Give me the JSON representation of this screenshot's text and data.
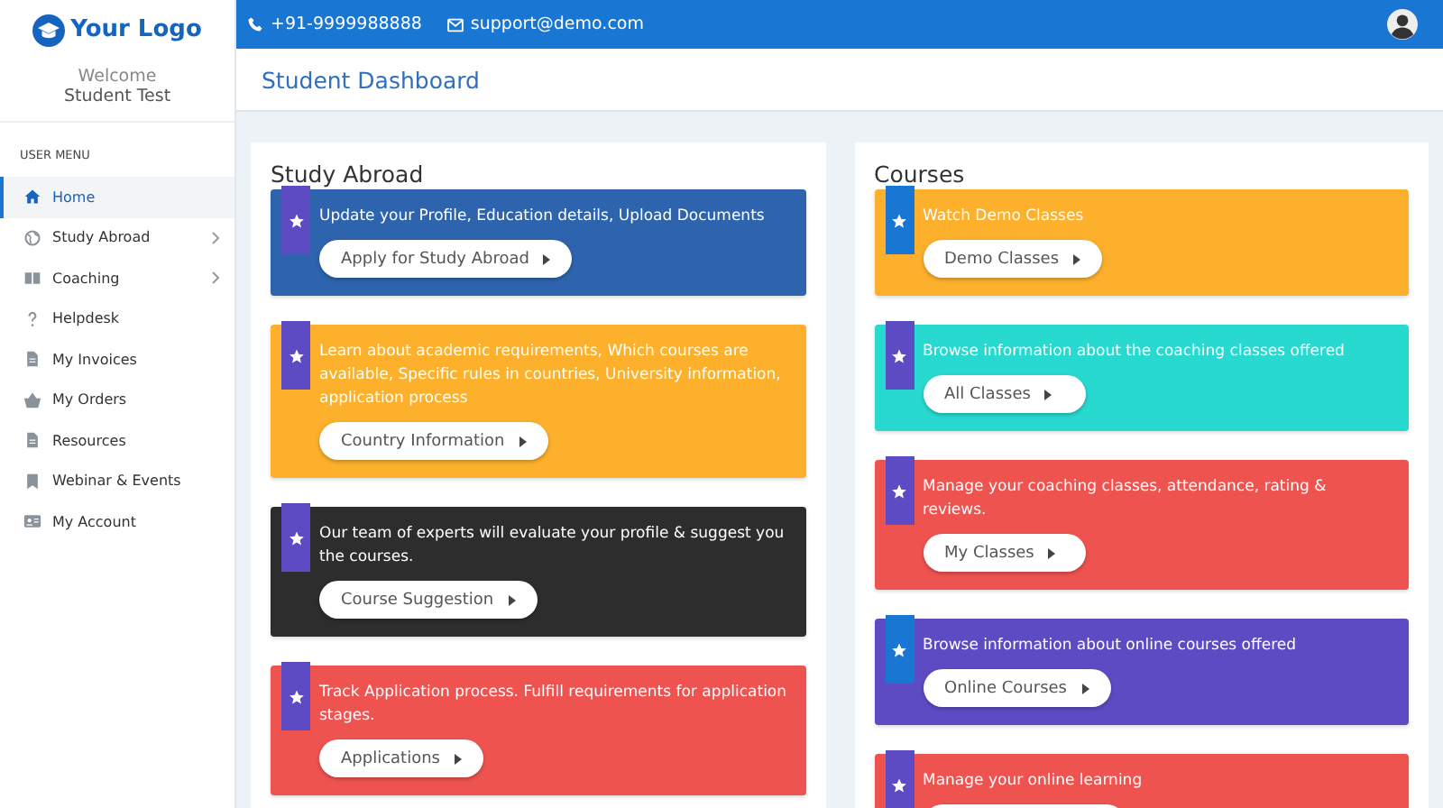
{
  "logo": {
    "text": "Your Logo"
  },
  "welcome": {
    "greeting": "Welcome",
    "name": "Student Test"
  },
  "topbar": {
    "phone": "+91-9999988888",
    "email": "support@demo.com"
  },
  "sidebar": {
    "heading": "USER MENU",
    "items": [
      {
        "label": "Home",
        "selected": true,
        "expandable": false
      },
      {
        "label": "Study Abroad",
        "selected": false,
        "expandable": true
      },
      {
        "label": "Coaching",
        "selected": false,
        "expandable": true
      },
      {
        "label": "Helpdesk",
        "selected": false,
        "expandable": false
      },
      {
        "label": "My Invoices",
        "selected": false,
        "expandable": false
      },
      {
        "label": "My Orders",
        "selected": false,
        "expandable": false
      },
      {
        "label": "Resources",
        "selected": false,
        "expandable": false
      },
      {
        "label": "Webinar & Events",
        "selected": false,
        "expandable": false
      },
      {
        "label": "My Account",
        "selected": false,
        "expandable": false
      }
    ]
  },
  "page_title": "Student Dashboard",
  "panels": [
    {
      "title": "Study Abroad",
      "cards": [
        {
          "text": "Update your Profile, Education details, Upload Documents",
          "button": "Apply for Study Abroad",
          "color": "#2e64ae",
          "ribbon": {
            "color": "#5d4bc4"
          }
        },
        {
          "text": "Learn about academic requirements, Which courses are available, Specific rules in countries, University information, application process",
          "button": "Country Information",
          "color": "#fcb02c",
          "ribbon": {
            "color": "#5d4bc4"
          }
        },
        {
          "text": "Our team of experts will evaluate your profile & suggest you the courses.",
          "button": "Course Suggestion",
          "color": "#2d2d2d",
          "ribbon": {
            "color": "#5d4bc4"
          }
        },
        {
          "text": "Track Application process. Fulfill requirements for application stages.",
          "button": "Applications",
          "color": "#ef5350",
          "ribbon": {
            "color": "#5d4bc4"
          }
        }
      ]
    },
    {
      "title": "Courses",
      "cards": [
        {
          "text": "Watch Demo Classes",
          "button": "Demo Classes",
          "color": "#fcb02c",
          "ribbon": {
            "color": "#1976d2"
          }
        },
        {
          "text": "Browse information about the coaching classes offered",
          "button": "All Classes",
          "color": "#27d9cf",
          "ribbon": {
            "color": "#5d4bc4"
          }
        },
        {
          "text": "Manage your coaching classes, attendance, rating & reviews.",
          "button": "My Classes",
          "color": "#ef5350",
          "ribbon": {
            "color": "#5d4bc4"
          }
        },
        {
          "text": "Browse information about online courses offered",
          "button": "Online Courses",
          "color": "#5d4bc4",
          "ribbon": {
            "color": "#1976d2"
          }
        },
        {
          "text": "Manage your online learning",
          "color": "#ef5350",
          "ribbon": {
            "color": "#5d4bc4"
          }
        }
      ]
    }
  ]
}
